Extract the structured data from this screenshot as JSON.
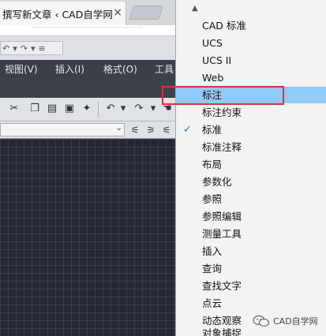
{
  "browser": {
    "tab_title": "撰写新文章 ‹ CAD自学网",
    "tab_close": "×"
  },
  "menubar": {
    "items": [
      "视图(V)",
      "插入(I)",
      "格式(O)",
      "工具"
    ]
  },
  "toolbar_menu": {
    "items": [
      {
        "label": "CAD 标准",
        "checked": false,
        "highlighted": false
      },
      {
        "label": "UCS",
        "checked": false,
        "highlighted": false
      },
      {
        "label": "UCS II",
        "checked": false,
        "highlighted": false
      },
      {
        "label": "Web",
        "checked": false,
        "highlighted": false
      },
      {
        "label": "标注",
        "checked": false,
        "highlighted": true
      },
      {
        "label": "标注约束",
        "checked": false,
        "highlighted": false
      },
      {
        "label": "标准",
        "checked": true,
        "highlighted": false
      },
      {
        "label": "标准注释",
        "checked": false,
        "highlighted": false
      },
      {
        "label": "布局",
        "checked": false,
        "highlighted": false
      },
      {
        "label": "参数化",
        "checked": false,
        "highlighted": false
      },
      {
        "label": "参照",
        "checked": false,
        "highlighted": false
      },
      {
        "label": "参照编辑",
        "checked": false,
        "highlighted": false
      },
      {
        "label": "测量工具",
        "checked": false,
        "highlighted": false
      },
      {
        "label": "插入",
        "checked": false,
        "highlighted": false
      },
      {
        "label": "查询",
        "checked": false,
        "highlighted": false
      },
      {
        "label": "查找文字",
        "checked": false,
        "highlighted": false
      },
      {
        "label": "点云",
        "checked": false,
        "highlighted": false
      },
      {
        "label": "动态观察",
        "checked": false,
        "highlighted": false
      },
      {
        "label": "对象捕捉",
        "checked": false,
        "highlighted": false
      }
    ]
  },
  "watermark": {
    "text": "CAD自学网"
  },
  "colors": {
    "highlight": "#91c9f7",
    "annotation_box": "#d9323a",
    "canvas_bg": "#232833",
    "menubar_bg": "#3a3f48"
  }
}
